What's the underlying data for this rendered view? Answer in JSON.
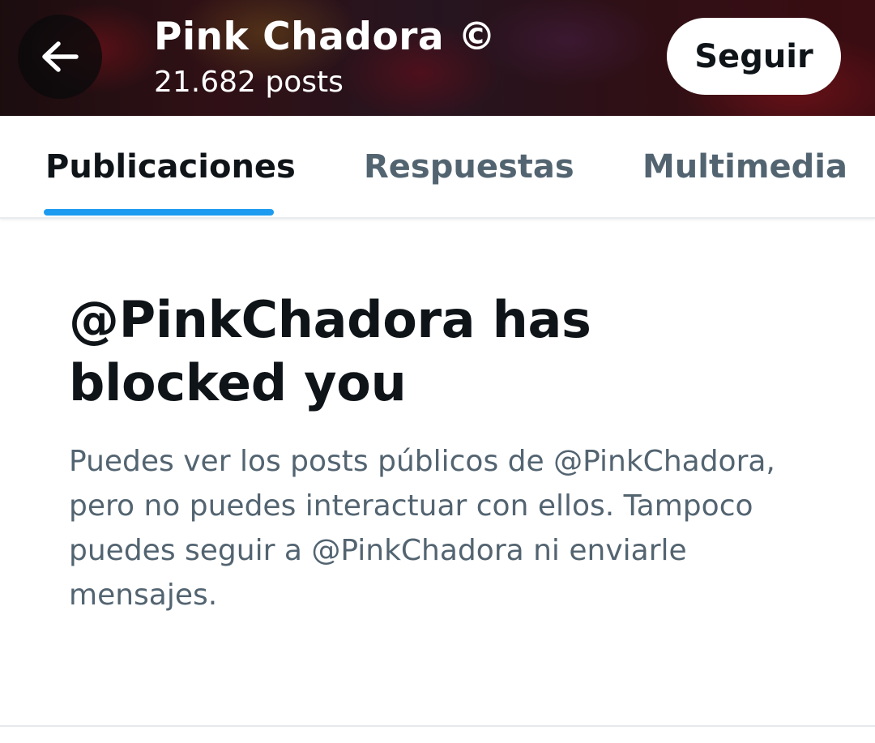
{
  "header": {
    "back_icon": "arrow-left-icon",
    "profile_name": "Pink Chadora ©",
    "post_count": "21.682 posts",
    "follow_label": "Seguir"
  },
  "tabs": [
    {
      "label": "Publicaciones",
      "active": true
    },
    {
      "label": "Respuestas",
      "active": false
    },
    {
      "label": "Multimedia",
      "active": false
    }
  ],
  "blocked": {
    "title": "@PinkChadora has blocked you",
    "description": "Puedes ver los posts públicos de @PinkChadora, pero no puedes interactuar con ellos. Tampoco puedes seguir a @PinkChadora ni enviarle mensajes."
  },
  "colors": {
    "accent": "#1d9bf0",
    "text_primary": "#0f1419",
    "text_secondary": "#536471"
  }
}
